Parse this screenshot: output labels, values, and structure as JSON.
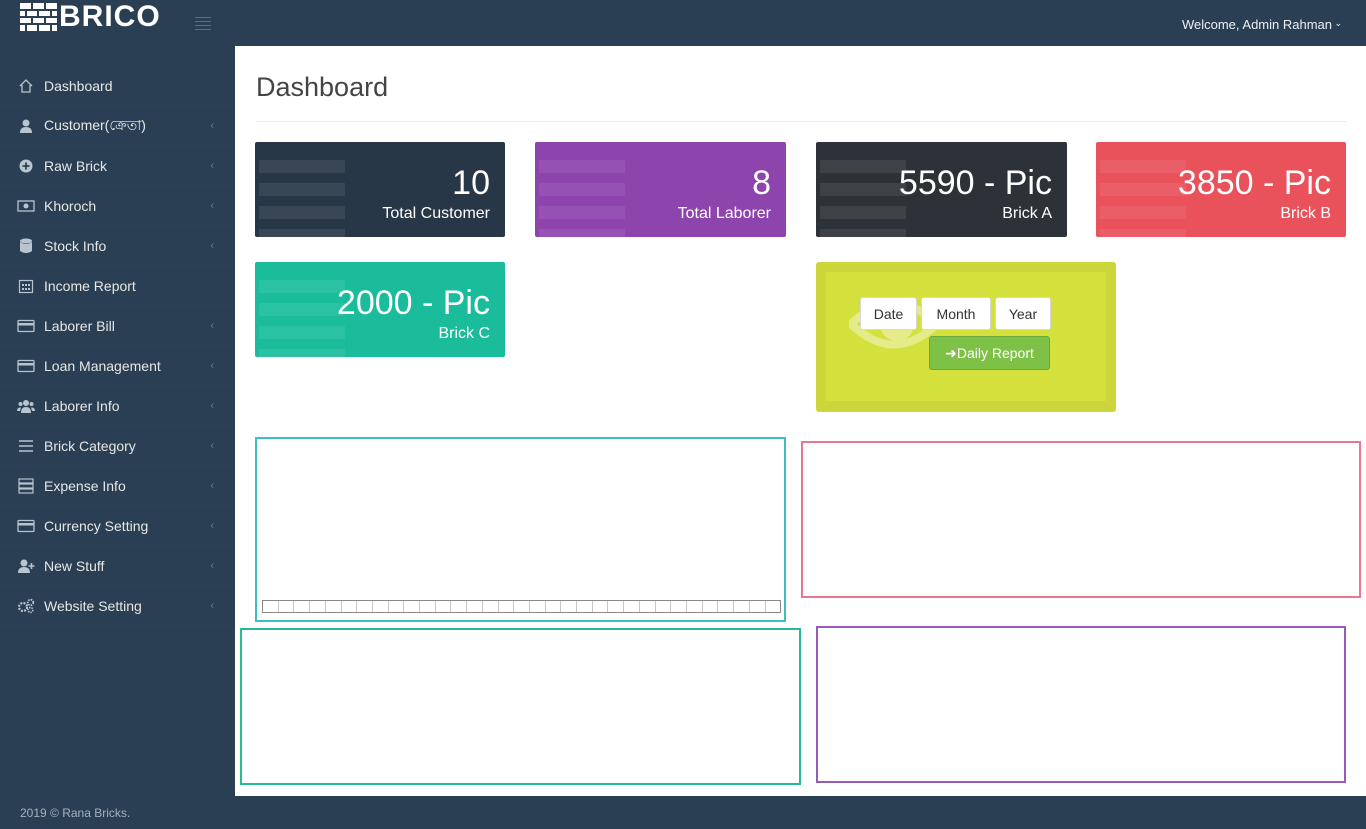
{
  "app": {
    "brand": "BRICO"
  },
  "header": {
    "welcome": "Welcome, Admin Rahman"
  },
  "sidebar": {
    "items": [
      {
        "label": "Dashboard",
        "icon": "home-icon",
        "chevron": false
      },
      {
        "label": "Customer(ক্রেতা)",
        "icon": "user-icon",
        "chevron": true
      },
      {
        "label": "Raw Brick",
        "icon": "plus-circle-icon",
        "chevron": true
      },
      {
        "label": "Khoroch",
        "icon": "money-icon",
        "chevron": true
      },
      {
        "label": "Stock Info",
        "icon": "database-icon",
        "chevron": true
      },
      {
        "label": "Income Report",
        "icon": "calendar-icon",
        "chevron": false
      },
      {
        "label": "Laborer Bill",
        "icon": "credit-card-icon",
        "chevron": true
      },
      {
        "label": "Loan Management",
        "icon": "credit-card-icon",
        "chevron": true
      },
      {
        "label": "Laborer Info",
        "icon": "users-icon",
        "chevron": true
      },
      {
        "label": "Brick Category",
        "icon": "bars-icon",
        "chevron": true
      },
      {
        "label": "Expense Info",
        "icon": "server-icon",
        "chevron": true
      },
      {
        "label": "Currency Setting",
        "icon": "credit-card-icon",
        "chevron": true
      },
      {
        "label": "New Stuff",
        "icon": "user-plus-icon",
        "chevron": true
      },
      {
        "label": "Website Setting",
        "icon": "cogs-icon",
        "chevron": true
      }
    ]
  },
  "footer": {
    "text": "2019 © Rana Bricks."
  },
  "main": {
    "title": "Dashboard",
    "cards": [
      {
        "value": "10",
        "label": "Total Customer",
        "color": "#283747"
      },
      {
        "value": "8",
        "label": "Total Laborer",
        "color": "#8e44ad"
      },
      {
        "value": "5590 - Pic",
        "label": "Brick A",
        "color": "#2d3238"
      },
      {
        "value": "3850 - Pic",
        "label": "Brick B",
        "color": "#e9515b"
      },
      {
        "value": "2000 - Pic",
        "label": "Brick C",
        "color": "#1abc9c"
      }
    ],
    "report": {
      "buttons": [
        "Date",
        "Month",
        "Year"
      ],
      "daily_label": "Daily Report"
    }
  },
  "colors": {
    "sidebar_bg": "#2a3f54",
    "report_bg": "#ccd63a",
    "panel_teal": "#3bbfc2",
    "panel_pink": "#e9758f",
    "panel_green": "#26b99a",
    "panel_purple": "#9b59b6"
  }
}
